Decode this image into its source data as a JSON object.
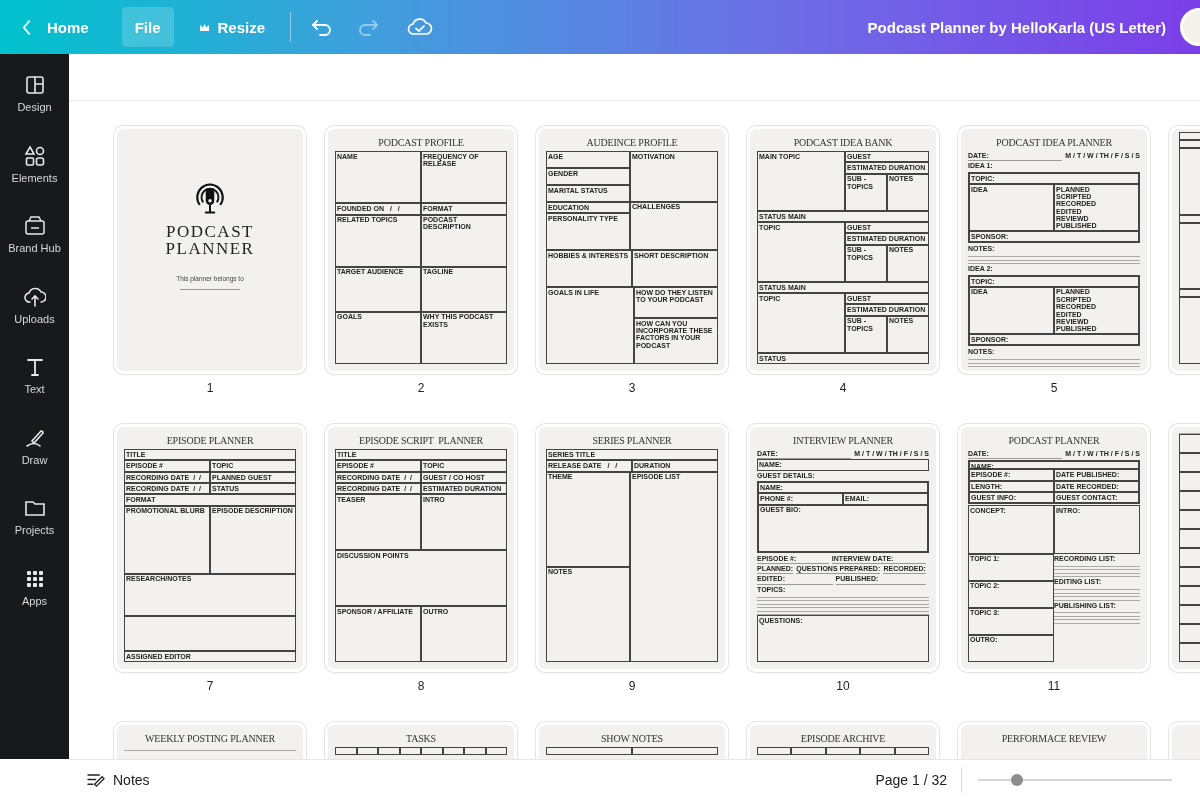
{
  "topbar": {
    "home": "Home",
    "menu": [
      {
        "label": "File",
        "selected": true
      },
      {
        "label": "Resize",
        "selected": false
      }
    ],
    "history": [
      {
        "kind": "undo",
        "disabled": false
      },
      {
        "kind": "redo",
        "disabled": true
      }
    ],
    "title": "Podcast Planner by HelloKarla (US Letter)"
  },
  "sidebar": [
    {
      "label": "Design",
      "kind": "design"
    },
    {
      "label": "Elements",
      "kind": "elements"
    },
    {
      "label": "Brand Hub",
      "kind": "brand"
    },
    {
      "label": "Uploads",
      "kind": "uploads"
    },
    {
      "label": "Text",
      "kind": "text"
    },
    {
      "label": "Draw",
      "kind": "draw"
    },
    {
      "label": "Projects",
      "kind": "projects"
    },
    {
      "label": "Apps",
      "kind": "apps"
    }
  ],
  "pages": [
    {
      "kind": "cover",
      "title_lines": [
        "PODCAST",
        "PLANNER"
      ],
      "caption": "This planner belongs to",
      "number": "1"
    },
    {
      "kind": "form",
      "title": "PODCAST PROFILE",
      "number": "2",
      "form": {
        "kind": "stack",
        "cells": [
          {
            "kind": "row",
            "cells": [
              {
                "kind": "box",
                "label": "NAME"
              },
              {
                "kind": "box",
                "label": "FREQUENCY OF RELEASE"
              }
            ]
          },
          {
            "kind": "row",
            "cells": [
              {
                "kind": "line",
                "label": "FOUNDED ON   /   /"
              },
              {
                "kind": "line",
                "label": "FORMAT"
              }
            ]
          },
          {
            "kind": "row",
            "cells": [
              {
                "kind": "box",
                "label": "RELATED TOPICS"
              },
              {
                "kind": "box",
                "label": "PODCAST DESCRIPTION"
              }
            ]
          },
          {
            "kind": "row",
            "cells": [
              {
                "kind": "box",
                "label": "TARGET AUDIENCE"
              },
              {
                "kind": "box",
                "label": "TAGLINE"
              }
            ]
          },
          {
            "kind": "row",
            "cells": [
              {
                "kind": "box",
                "label": "GOALS"
              },
              {
                "kind": "box",
                "label": "WHY THIS PODCAST EXISTS"
              }
            ]
          }
        ]
      }
    },
    {
      "kind": "form",
      "title": "AUDEINCE PROFILE",
      "number": "3",
      "form": {
        "kind": "stack",
        "cells": [
          {
            "kind": "row",
            "cells": [
              {
                "kind": "stack",
                "cells": [
                  {
                    "kind": "line",
                    "label": "AGE"
                  },
                  {
                    "kind": "line",
                    "label": "GENDER"
                  },
                  {
                    "kind": "line",
                    "label": "MARITAL STATUS"
                  }
                ]
              },
              {
                "kind": "box",
                "label": "MOTIVATION"
              }
            ]
          },
          {
            "kind": "row",
            "cells": [
              {
                "kind": "stack",
                "cells": [
                  {
                    "kind": "line",
                    "label": "EDUCATION"
                  },
                  {
                    "kind": "box",
                    "label": "PERSONALITY TYPE"
                  }
                ]
              },
              {
                "kind": "box",
                "label": "CHALLENGES"
              }
            ]
          },
          {
            "kind": "row",
            "cells": [
              {
                "kind": "box",
                "label": "HOBBIES & INTERESTS"
              },
              {
                "kind": "box",
                "label": "SHORT DESCRIPTION"
              }
            ]
          },
          {
            "kind": "row",
            "cells": [
              {
                "kind": "box",
                "label": "GOALS IN LIFE"
              },
              {
                "kind": "stack",
                "cells": [
                  {
                    "kind": "box",
                    "label": "HOW DO THEY LISTEN TO YOUR PODCAST"
                  },
                  {
                    "kind": "box",
                    "label": "HOW CAN YOU INCORPORATE THESE FACTORS IN YOUR PODCAST"
                  }
                ]
              }
            ]
          }
        ]
      }
    },
    {
      "kind": "form",
      "title": "PODCAST IDEA BANK",
      "number": "4",
      "form": {
        "kind": "stack",
        "cells": [
          {
            "kind": "row",
            "cells": [
              {
                "kind": "box",
                "label": "MAIN TOPIC"
              },
              {
                "kind": "stack",
                "cells": [
                  {
                    "kind": "line",
                    "label": "GUEST"
                  },
                  {
                    "kind": "line",
                    "label": "ESTIMATED DURATION"
                  },
                  {
                    "kind": "row",
                    "cells": [
                      {
                        "kind": "box",
                        "label": "SUB - TOPICS"
                      },
                      {
                        "kind": "box",
                        "label": "NOTES"
                      }
                    ]
                  }
                ]
              }
            ]
          },
          {
            "kind": "line",
            "label": "STATUS MAIN"
          },
          {
            "kind": "row",
            "cells": [
              {
                "kind": "box",
                "label": "TOPIC"
              },
              {
                "kind": "stack",
                "cells": [
                  {
                    "kind": "line",
                    "label": "GUEST"
                  },
                  {
                    "kind": "line",
                    "label": "ESTIMATED DURATION"
                  },
                  {
                    "kind": "row",
                    "cells": [
                      {
                        "kind": "box",
                        "label": "SUB - TOPICS"
                      },
                      {
                        "kind": "box",
                        "label": "NOTES"
                      }
                    ]
                  }
                ]
              }
            ]
          },
          {
            "kind": "line",
            "label": "STATUS MAIN"
          },
          {
            "kind": "row",
            "cells": [
              {
                "kind": "box",
                "label": "TOPIC"
              },
              {
                "kind": "stack",
                "cells": [
                  {
                    "kind": "line",
                    "label": "GUEST"
                  },
                  {
                    "kind": "line",
                    "label": "ESTIMATED DURATION"
                  },
                  {
                    "kind": "row",
                    "cells": [
                      {
                        "kind": "box",
                        "label": "SUB - TOPICS"
                      },
                      {
                        "kind": "box",
                        "label": "NOTES"
                      }
                    ]
                  }
                ]
              }
            ]
          },
          {
            "kind": "line",
            "label": "STATUS"
          }
        ]
      }
    },
    {
      "kind": "form",
      "title": "PODCAST IDEA PLANNER",
      "number": "5",
      "form": {
        "kind": "stack",
        "cells": [
          {
            "kind": "row",
            "cells": [
              {
                "kind": "field",
                "label": "DATE:"
              },
              {
                "kind": "text",
                "label": "M / T / W / TH / F / S / S"
              }
            ]
          },
          {
            "kind": "text",
            "label": "IDEA 1:"
          },
          {
            "kind": "group",
            "cells": [
              {
                "kind": "line",
                "label": "TOPIC:"
              },
              {
                "kind": "row",
                "cells": [
                  {
                    "kind": "box",
                    "label": "IDEA"
                  },
                  {
                    "kind": "box",
                    "items": [
                      "PLANNED",
                      "SCRIPTED",
                      "RECORDED",
                      "EDITED",
                      "REVIEWD",
                      "PUBLISHED"
                    ]
                  }
                ]
              },
              {
                "kind": "line",
                "label": "SPONSOR:"
              }
            ]
          },
          {
            "kind": "text",
            "label": "NOTES:"
          },
          {
            "kind": "rule"
          },
          {
            "kind": "rule"
          },
          {
            "kind": "rule"
          },
          {
            "kind": "text",
            "label": "IDEA 2:"
          },
          {
            "kind": "group",
            "cells": [
              {
                "kind": "line",
                "label": "TOPIC:"
              },
              {
                "kind": "row",
                "cells": [
                  {
                    "kind": "box",
                    "label": "IDEA"
                  },
                  {
                    "kind": "box",
                    "items": [
                      "PLANNED",
                      "SCRIPTED",
                      "RECORDED",
                      "EDITED",
                      "REVIEWD",
                      "PUBLISHED"
                    ]
                  }
                ]
              },
              {
                "kind": "line",
                "label": "SPONSOR:"
              }
            ]
          },
          {
            "kind": "text",
            "label": "NOTES:"
          },
          {
            "kind": "rule"
          },
          {
            "kind": "rule"
          },
          {
            "kind": "rule"
          }
        ]
      }
    },
    {
      "kind": "form",
      "form": {
        "kind": "stack",
        "cells": [
          {
            "kind": "line"
          },
          {
            "kind": "line"
          },
          {
            "kind": "box"
          },
          {
            "kind": "line"
          },
          {
            "kind": "box"
          },
          {
            "kind": "line"
          },
          {
            "kind": "box"
          }
        ]
      }
    },
    {
      "kind": "form",
      "title": "EPISODE PLANNER",
      "number": "7",
      "form": {
        "kind": "stack",
        "cells": [
          {
            "kind": "line",
            "label": "TITLE"
          },
          {
            "kind": "row",
            "cells": [
              {
                "kind": "line",
                "label": "EPISODE #"
              },
              {
                "kind": "line",
                "label": "TOPIC"
              }
            ]
          },
          {
            "kind": "row",
            "cells": [
              {
                "kind": "line",
                "label": "RECORDING DATE  /  /"
              },
              {
                "kind": "line",
                "label": "PLANNED GUEST"
              }
            ]
          },
          {
            "kind": "row",
            "cells": [
              {
                "kind": "line",
                "label": "RECORDING DATE  /  /"
              },
              {
                "kind": "line",
                "label": "STATUS"
              }
            ]
          },
          {
            "kind": "line",
            "label": "FORMAT"
          },
          {
            "kind": "row",
            "cells": [
              {
                "kind": "box",
                "label": "PROMOTIONAL BLURB"
              },
              {
                "kind": "box",
                "label": "EPISODE DESCRIPTION"
              }
            ]
          },
          {
            "kind": "stack",
            "cells": [
              {
                "kind": "box",
                "label": "RESEARCH/NOTES"
              },
              {
                "kind": "box"
              }
            ]
          },
          {
            "kind": "line",
            "label": "ASSIGNED EDITOR"
          }
        ]
      }
    },
    {
      "kind": "form",
      "title": "EPISODE SCRIPT  PLANNER",
      "number": "8",
      "form": {
        "kind": "stack",
        "cells": [
          {
            "kind": "line",
            "label": "TITLE"
          },
          {
            "kind": "row",
            "cells": [
              {
                "kind": "line",
                "label": "EPISODE #"
              },
              {
                "kind": "line",
                "label": "TOPIC"
              }
            ]
          },
          {
            "kind": "row",
            "cells": [
              {
                "kind": "line",
                "label": "RECORDING DATE  /  /"
              },
              {
                "kind": "line",
                "label": "GUEST / CO HOST"
              }
            ]
          },
          {
            "kind": "row",
            "cells": [
              {
                "kind": "line",
                "label": "RECORDING DATE  /  /"
              },
              {
                "kind": "line",
                "label": "ESTIMATED DURATION"
              }
            ]
          },
          {
            "kind": "row",
            "cells": [
              {
                "kind": "box",
                "label": "TEASER"
              },
              {
                "kind": "box",
                "label": "INTRO"
              }
            ]
          },
          {
            "kind": "box",
            "label": "DISCUSSION POINTS"
          },
          {
            "kind": "row",
            "cells": [
              {
                "kind": "box",
                "label": "SPONSOR / AFFILIATE"
              },
              {
                "kind": "box",
                "label": "OUTRO"
              }
            ]
          }
        ]
      }
    },
    {
      "kind": "form",
      "title": "SERIES PLANNER",
      "number": "9",
      "form": {
        "kind": "stack",
        "cells": [
          {
            "kind": "line",
            "label": "SERIES TITLE"
          },
          {
            "kind": "row",
            "cells": [
              {
                "kind": "line",
                "label": "RELEASE DATE   /   /"
              },
              {
                "kind": "line",
                "label": "DURATION"
              }
            ]
          },
          {
            "kind": "row",
            "cells": [
              {
                "kind": "stack",
                "cells": [
                  {
                    "kind": "box",
                    "label": "THEME"
                  },
                  {
                    "kind": "box",
                    "label": "NOTES"
                  }
                ]
              },
              {
                "kind": "box",
                "label": "EPISODE LIST"
              }
            ]
          }
        ]
      }
    },
    {
      "kind": "form",
      "title": "INTERVIEW PLANNER",
      "number": "10",
      "form": {
        "kind": "stack",
        "cells": [
          {
            "kind": "row",
            "cells": [
              {
                "kind": "field",
                "label": "DATE:"
              },
              {
                "kind": "text",
                "label": "M / T / W / TH / F / S / S"
              }
            ]
          },
          {
            "kind": "line",
            "label": "NAME:"
          },
          {
            "kind": "text",
            "label": "GUEST DETAILS:"
          },
          {
            "kind": "group",
            "cells": [
              {
                "kind": "line",
                "label": "NAME:"
              },
              {
                "kind": "row",
                "cells": [
                  {
                    "kind": "line",
                    "label": "PHONE #:"
                  },
                  {
                    "kind": "line",
                    "label": "EMAIL:"
                  }
                ]
              },
              {
                "kind": "box",
                "label": "GUEST BIO:"
              }
            ]
          },
          {
            "kind": "row",
            "cells": [
              {
                "kind": "field",
                "label": "EPISODE #:"
              },
              {
                "kind": "field",
                "label": "INTERVIEW DATE:"
              }
            ]
          },
          {
            "kind": "row",
            "cells": [
              {
                "kind": "field",
                "label": "PLANNED:"
              },
              {
                "kind": "field",
                "label": "QUESTIONS PREPARED:"
              },
              {
                "kind": "field",
                "label": "RECORDED:"
              },
              {
                "kind": "field",
                "label": "EDITED:"
              },
              {
                "kind": "field",
                "label": "PUBLISHED:"
              }
            ]
          },
          {
            "kind": "text",
            "label": "TOPICS:"
          },
          {
            "kind": "rule"
          },
          {
            "kind": "rule"
          },
          {
            "kind": "rule"
          },
          {
            "kind": "rule"
          },
          {
            "kind": "rule"
          },
          {
            "kind": "rule"
          },
          {
            "kind": "box",
            "label": "QUESTIONS:"
          }
        ]
      }
    },
    {
      "kind": "form",
      "title": "PODCAST PLANNER",
      "number": "11",
      "form": {
        "kind": "stack",
        "cells": [
          {
            "kind": "row",
            "cells": [
              {
                "kind": "field",
                "label": "DATE:"
              },
              {
                "kind": "text",
                "label": "M / T / W / TH / F / S / S"
              }
            ]
          },
          {
            "kind": "group",
            "cells": [
              {
                "kind": "line",
                "label": "NAME:"
              },
              {
                "kind": "row",
                "cells": [
                  {
                    "kind": "line",
                    "label": "EPISODE #:"
                  },
                  {
                    "kind": "line",
                    "label": "DATE PUBLISHED:"
                  }
                ]
              },
              {
                "kind": "row",
                "cells": [
                  {
                    "kind": "line",
                    "label": "LENGTH:"
                  },
                  {
                    "kind": "line",
                    "label": "DATE RECORDED:"
                  }
                ]
              },
              {
                "kind": "row",
                "cells": [
                  {
                    "kind": "line",
                    "label": "GUEST INFO:"
                  },
                  {
                    "kind": "line",
                    "label": "GUEST CONTACT:"
                  }
                ]
              }
            ]
          },
          {
            "kind": "row",
            "cells": [
              {
                "kind": "box",
                "label": "CONCEPT:"
              },
              {
                "kind": "box",
                "label": "INTRO:"
              }
            ]
          },
          {
            "kind": "row",
            "cells": [
              {
                "kind": "stack",
                "cells": [
                  {
                    "kind": "box",
                    "label": "TOPIC 1:"
                  },
                  {
                    "kind": "box",
                    "label": "TOPIC 2:"
                  },
                  {
                    "kind": "box",
                    "label": "TOPIC 3:"
                  },
                  {
                    "kind": "box",
                    "label": "OUTRO:"
                  }
                ]
              },
              {
                "kind": "stack",
                "cells": [
                  {
                    "kind": "text",
                    "label": "RECORDING LIST:"
                  },
                  {
                    "kind": "rule"
                  },
                  {
                    "kind": "rule"
                  },
                  {
                    "kind": "rule"
                  },
                  {
                    "kind": "rule"
                  },
                  {
                    "kind": "text",
                    "label": "EDITING LIST:"
                  },
                  {
                    "kind": "rule"
                  },
                  {
                    "kind": "rule"
                  },
                  {
                    "kind": "rule"
                  },
                  {
                    "kind": "rule"
                  },
                  {
                    "kind": "text",
                    "label": "PUBLISHING LIST:"
                  },
                  {
                    "kind": "rule"
                  },
                  {
                    "kind": "rule"
                  },
                  {
                    "kind": "rule"
                  },
                  {
                    "kind": "rule"
                  }
                ]
              }
            ]
          }
        ]
      }
    },
    {
      "kind": "form",
      "form": {
        "kind": "stack",
        "cells": [
          {
            "kind": "rule"
          },
          {
            "kind": "line"
          },
          {
            "kind": "line"
          },
          {
            "kind": "line"
          },
          {
            "kind": "line"
          },
          {
            "kind": "line"
          },
          {
            "kind": "line"
          },
          {
            "kind": "line"
          },
          {
            "kind": "line"
          },
          {
            "kind": "line"
          },
          {
            "kind": "line"
          },
          {
            "kind": "line"
          },
          {
            "kind": "line"
          }
        ]
      }
    },
    {
      "kind": "form",
      "title": "WEEKLY POSTING PLANNER",
      "form": {
        "kind": "stack",
        "cells": [
          {
            "kind": "rule"
          }
        ]
      }
    },
    {
      "kind": "form",
      "title": "TASKS",
      "form": {
        "kind": "stack",
        "cells": [
          {
            "kind": "row",
            "cells": [
              {
                "kind": "line"
              },
              {
                "kind": "line"
              },
              {
                "kind": "line"
              },
              {
                "kind": "line"
              },
              {
                "kind": "line"
              },
              {
                "kind": "line"
              },
              {
                "kind": "line"
              },
              {
                "kind": "line"
              }
            ]
          }
        ]
      }
    },
    {
      "kind": "form",
      "title": "SHOW NOTES",
      "form": {
        "kind": "stack",
        "cells": [
          {
            "kind": "row",
            "cells": [
              {
                "kind": "line"
              },
              {
                "kind": "line"
              }
            ]
          }
        ]
      }
    },
    {
      "kind": "form",
      "title": "EPISODE ARCHIVE",
      "form": {
        "kind": "stack",
        "cells": [
          {
            "kind": "row",
            "cells": [
              {
                "kind": "line"
              },
              {
                "kind": "line"
              },
              {
                "kind": "line"
              },
              {
                "kind": "line"
              },
              {
                "kind": "line"
              }
            ]
          }
        ]
      }
    },
    {
      "kind": "form",
      "title": "PERFORMACE REVIEW"
    },
    {
      "kind": "form"
    }
  ],
  "footer": {
    "notes": "Notes",
    "page": "Page 1 / 32",
    "zoom": {
      "level": 0.2
    }
  }
}
